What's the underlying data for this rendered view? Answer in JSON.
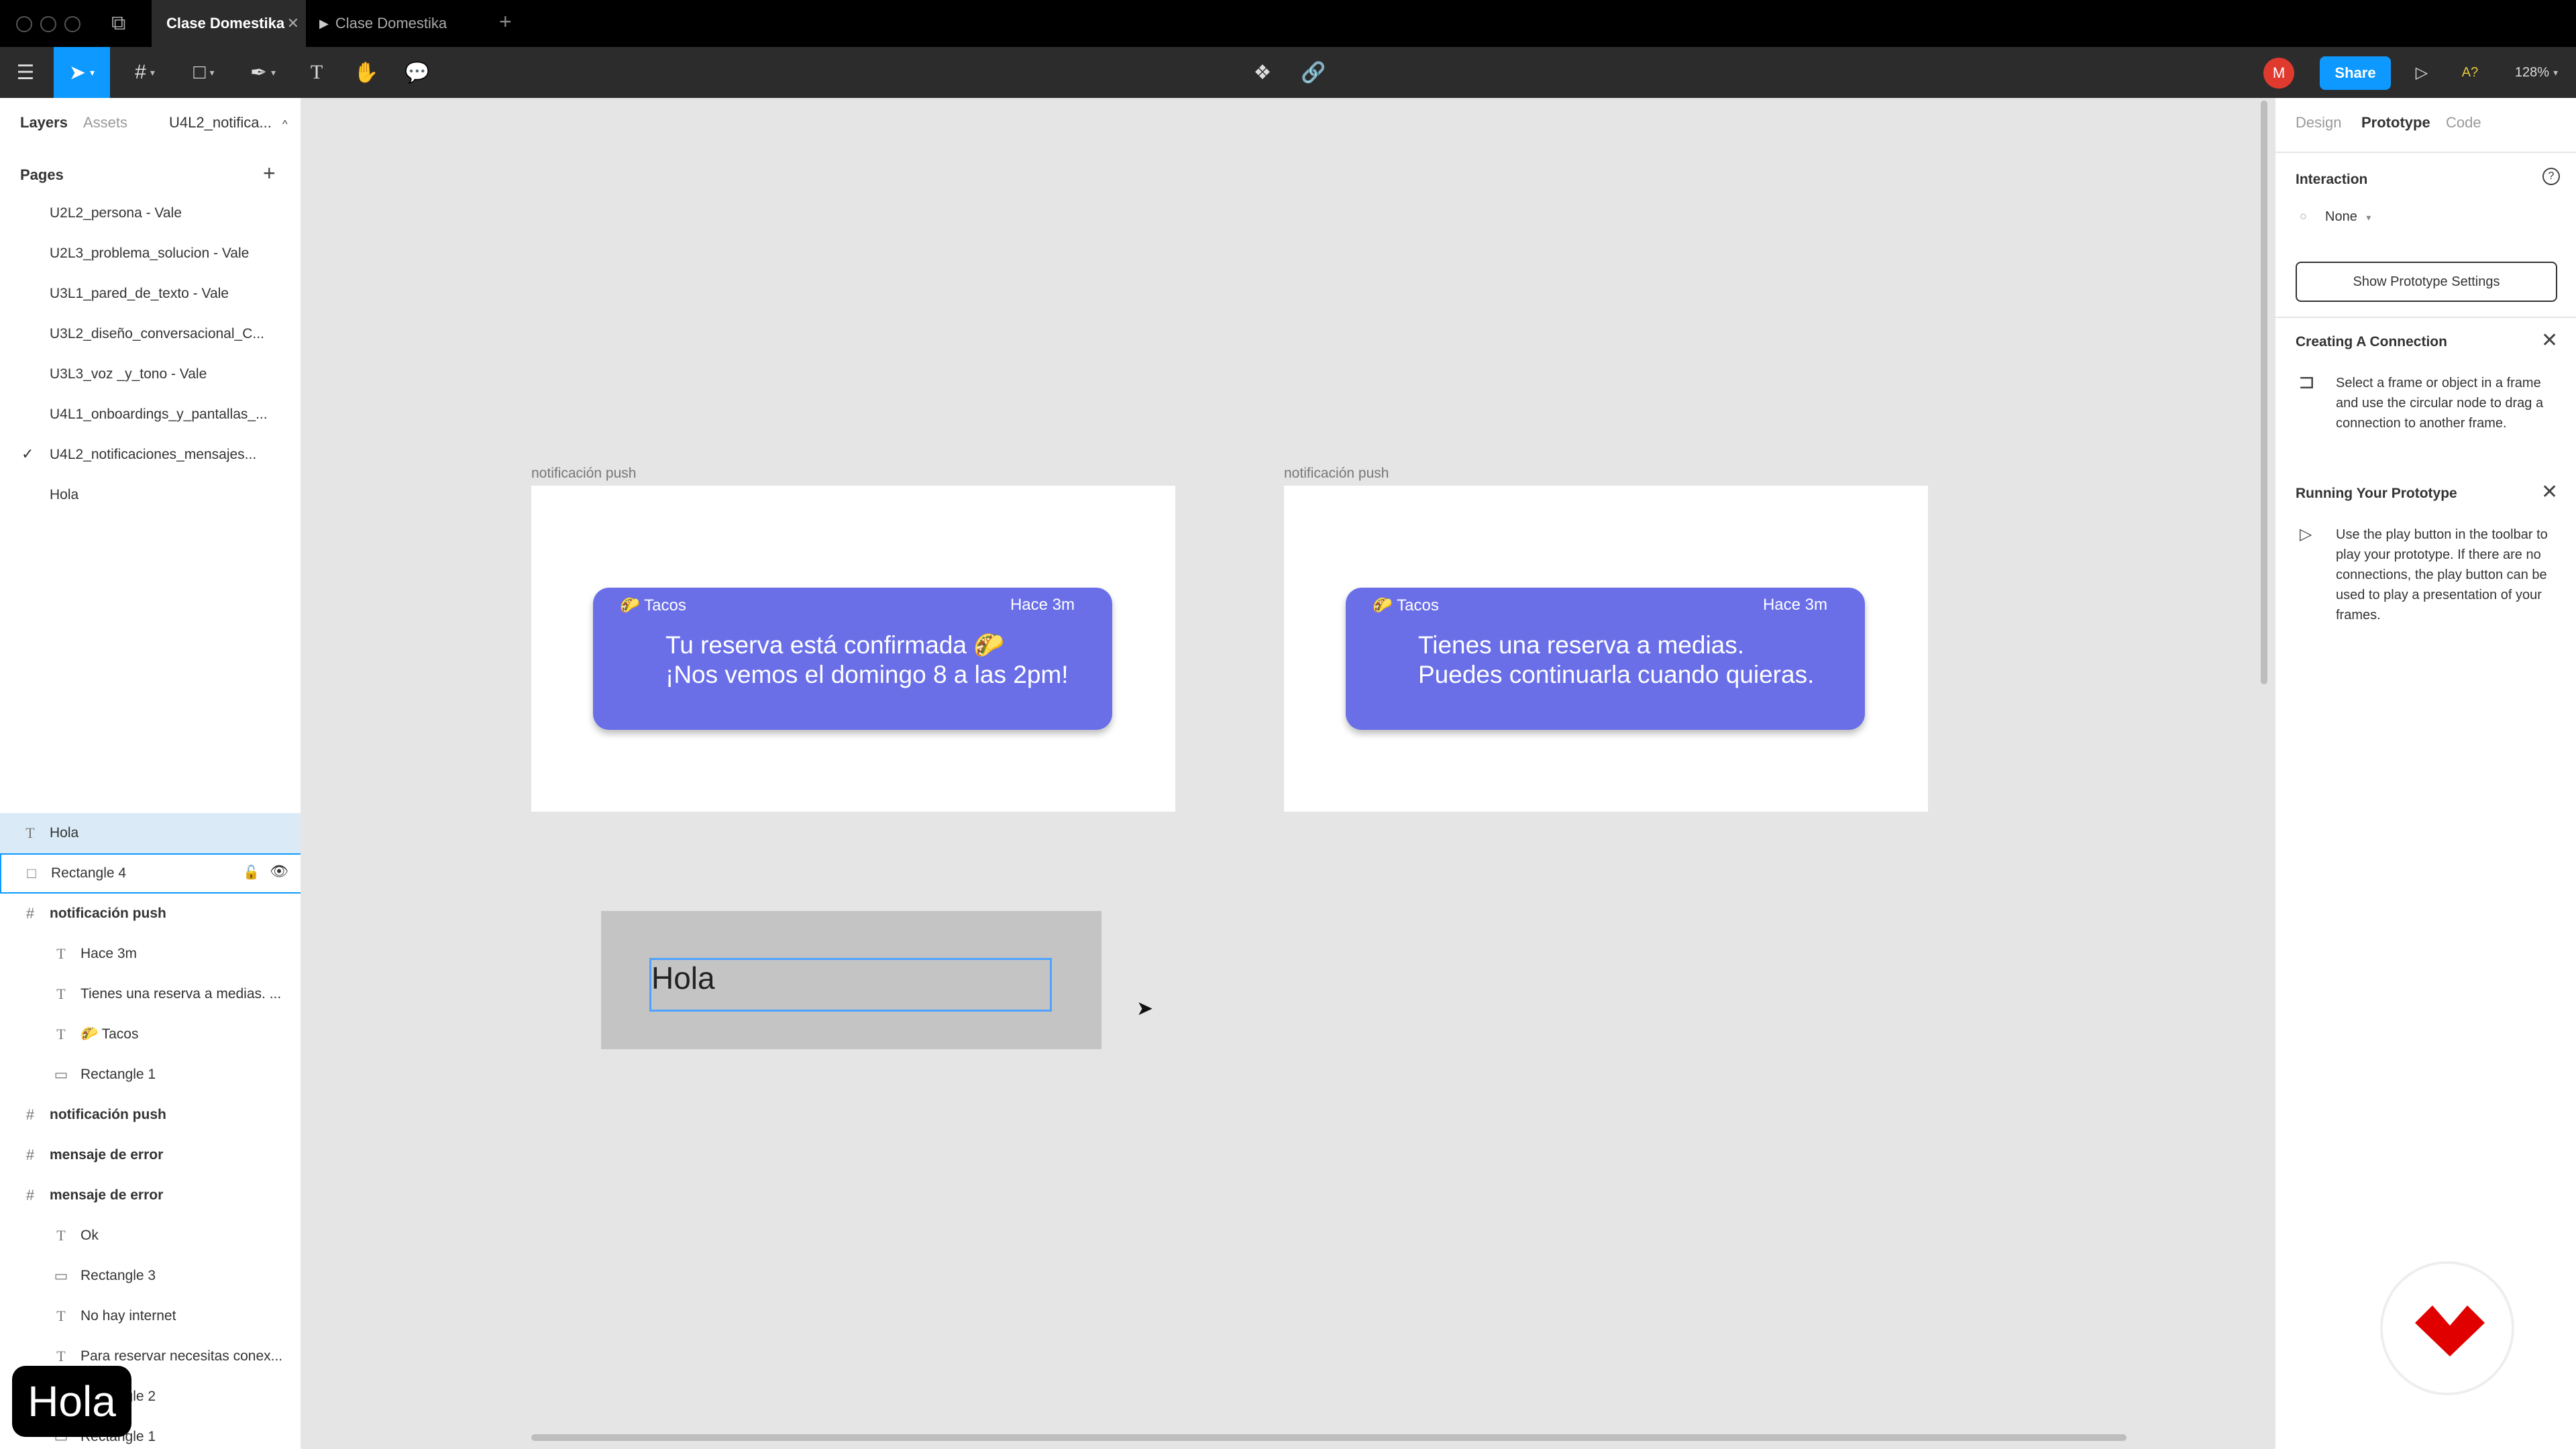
{
  "tabs": [
    {
      "label": "Clase Domestika",
      "active": true
    },
    {
      "label": "Clase Domestika",
      "active": false
    }
  ],
  "toolbar": {
    "avatar_letter": "M",
    "share_label": "Share",
    "a11y_label": "A?",
    "zoom": "128%"
  },
  "left_panel": {
    "tabs": [
      "Layers",
      "Assets"
    ],
    "current_page_short": "U4L2_notifica...",
    "pages_title": "Pages",
    "pages": [
      "U2L2_persona - Vale",
      "U2L3_problema_solucion - Vale",
      "U3L1_pared_de_texto - Vale",
      "U3L2_diseño_conversacional_C...",
      "U3L3_voz _y_tono - Vale",
      "U4L1_onboardings_y_pantallas_...",
      "U4L2_notificaciones_mensajes...",
      "Hola"
    ],
    "layers": [
      {
        "icon": "T",
        "label": "Hola"
      },
      {
        "icon": "□",
        "label": "Rectangle 4"
      },
      {
        "icon": "#",
        "label": "notificación push"
      },
      {
        "icon": "T",
        "label": "Hace 3m"
      },
      {
        "icon": "T",
        "label": "Tienes una reserva a medias. ..."
      },
      {
        "icon": "T",
        "label": "🌮 Tacos"
      },
      {
        "icon": "▭",
        "label": "Rectangle 1"
      },
      {
        "icon": "#",
        "label": "notificación push"
      },
      {
        "icon": "#",
        "label": "mensaje de error"
      },
      {
        "icon": "#",
        "label": "mensaje de error"
      },
      {
        "icon": "T",
        "label": "Ok"
      },
      {
        "icon": "▭",
        "label": "Rectangle 3"
      },
      {
        "icon": "T",
        "label": "No hay internet"
      },
      {
        "icon": "T",
        "label": "Para reservar necesitas conex..."
      },
      {
        "icon": "▭",
        "label": "Rectangle 2"
      },
      {
        "icon": "▭",
        "label": "Rectangle 1"
      }
    ]
  },
  "canvas": {
    "frames": [
      {
        "label": "notificación push",
        "app": "🌮 Tacos",
        "time": "Hace 3m",
        "line1": "Tu reserva está confirmada 🌮",
        "line2": "¡Nos vemos el domingo 8 a las 2pm!"
      },
      {
        "label": "notificación push",
        "app": "🌮 Tacos",
        "time": "Hace 3m",
        "line1": "Tienes una reserva a medias.",
        "line2": "Puedes continuarla cuando quieras."
      }
    ],
    "hola_text": "Hola"
  },
  "right_panel": {
    "tabs": [
      "Design",
      "Prototype",
      "Code"
    ],
    "interaction_title": "Interaction",
    "interaction_value": "None",
    "settings_button": "Show Prototype Settings",
    "connection_title": "Creating A Connection",
    "connection_text": "Select a frame or object in a frame and use the circular node to drag a connection to another frame.",
    "running_title": "Running Your Prototype",
    "running_text": "Use the play button in the toolbar to play your prototype. If there are no connections, the play button can be used to play a presentation of your frames."
  },
  "overlay_caption": "Hola"
}
